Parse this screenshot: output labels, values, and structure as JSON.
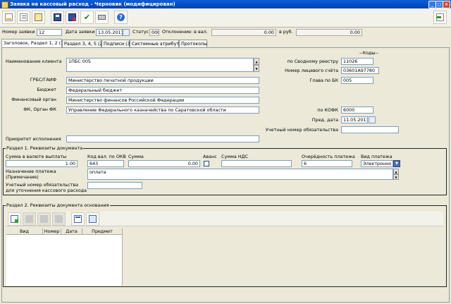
{
  "window": {
    "title": "Заявка на кассовый расход - Черновик (модифицирован)"
  },
  "toolbar": {
    "icons": [
      "new-doc-icon",
      "copy-doc-icon",
      "paste-doc-icon",
      "save-icon",
      "save-close-icon",
      "check-icon",
      "print-icon",
      "help-icon",
      "exit-icon"
    ]
  },
  "header": {
    "number_label": "Номер заявки",
    "number_value": "12",
    "date_label": "Дата заявки",
    "date_value": "13.05.2011",
    "status_label": "Статус",
    "status_value": "000",
    "deviation_label": "Отклонение: в вал.",
    "deviation_val": "0.00",
    "rub_label": "в руб.",
    "rub_val": "0.00"
  },
  "tabs": [
    "Заголовок, Раздел 1, 2 (1)",
    "Раздел 3, 4, 5 (2)",
    "Подписи (3)",
    "Системные атрибуты",
    "Протоколы"
  ],
  "main": {
    "codes_label": "--Коды--",
    "client_label": "Наименование клиента",
    "client_value": "1ПБС 005",
    "grbs_label": "ГРБС/ГАИФ",
    "grbs_value": "Министерство печатной продукции",
    "budget_label": "Бюджет",
    "budget_value": "Федеральный бюджет",
    "finorg_label": "Финансовый орган",
    "finorg_value": "Министерство финансов Российской Федерации",
    "fk_label": "ФК, Орган ФК",
    "fk_value": "Управление Федерального казначейства по Саратовской области",
    "priority_label": "Приоритет исполнения",
    "priority_value": "",
    "svod_label": "по Сводному реестру",
    "svod_value": "11026",
    "account_label": "Номер лицевого счёта",
    "account_value": "03601А97780",
    "glava_label": "Глава по БК",
    "glava_value": "005",
    "kofk_label": "по КОФК",
    "kofk_value": "6000",
    "pred_label": "Пред. дата",
    "pred_value": "11.05.2011",
    "obligation_label": "Учетный номер обязательства",
    "obligation_value": ""
  },
  "section1": {
    "title": "Раздел 1. Реквизиты документа",
    "sum_currency_label": "Сумма в валюте выплаты",
    "sum_currency_value": "1.00",
    "okv_label": "Код вал. по ОКВ",
    "okv_value": "643",
    "sum_label": "Сумма",
    "sum_value": "0.00",
    "avans_label": "Аванс",
    "nds_label": "Сумма НДС",
    "nds_value": "",
    "order_label": "Очерёдность платежа",
    "order_value": "6",
    "paytype_label": "Вид платежа",
    "paytype_value": "Электронно",
    "purpose_label1": "Назначение платежа",
    "purpose_label2": "(Примечание)",
    "purpose_value": "оплата",
    "oblig_label1": "Учетный номер обязательства",
    "oblig_label2": "для уточнения кассового расхода",
    "oblig_value": ""
  },
  "section2": {
    "title": "Раздел 2. Реквизиты документа основания",
    "columns": [
      "Вид",
      "Номер",
      "Дата",
      "Предмет"
    ]
  }
}
